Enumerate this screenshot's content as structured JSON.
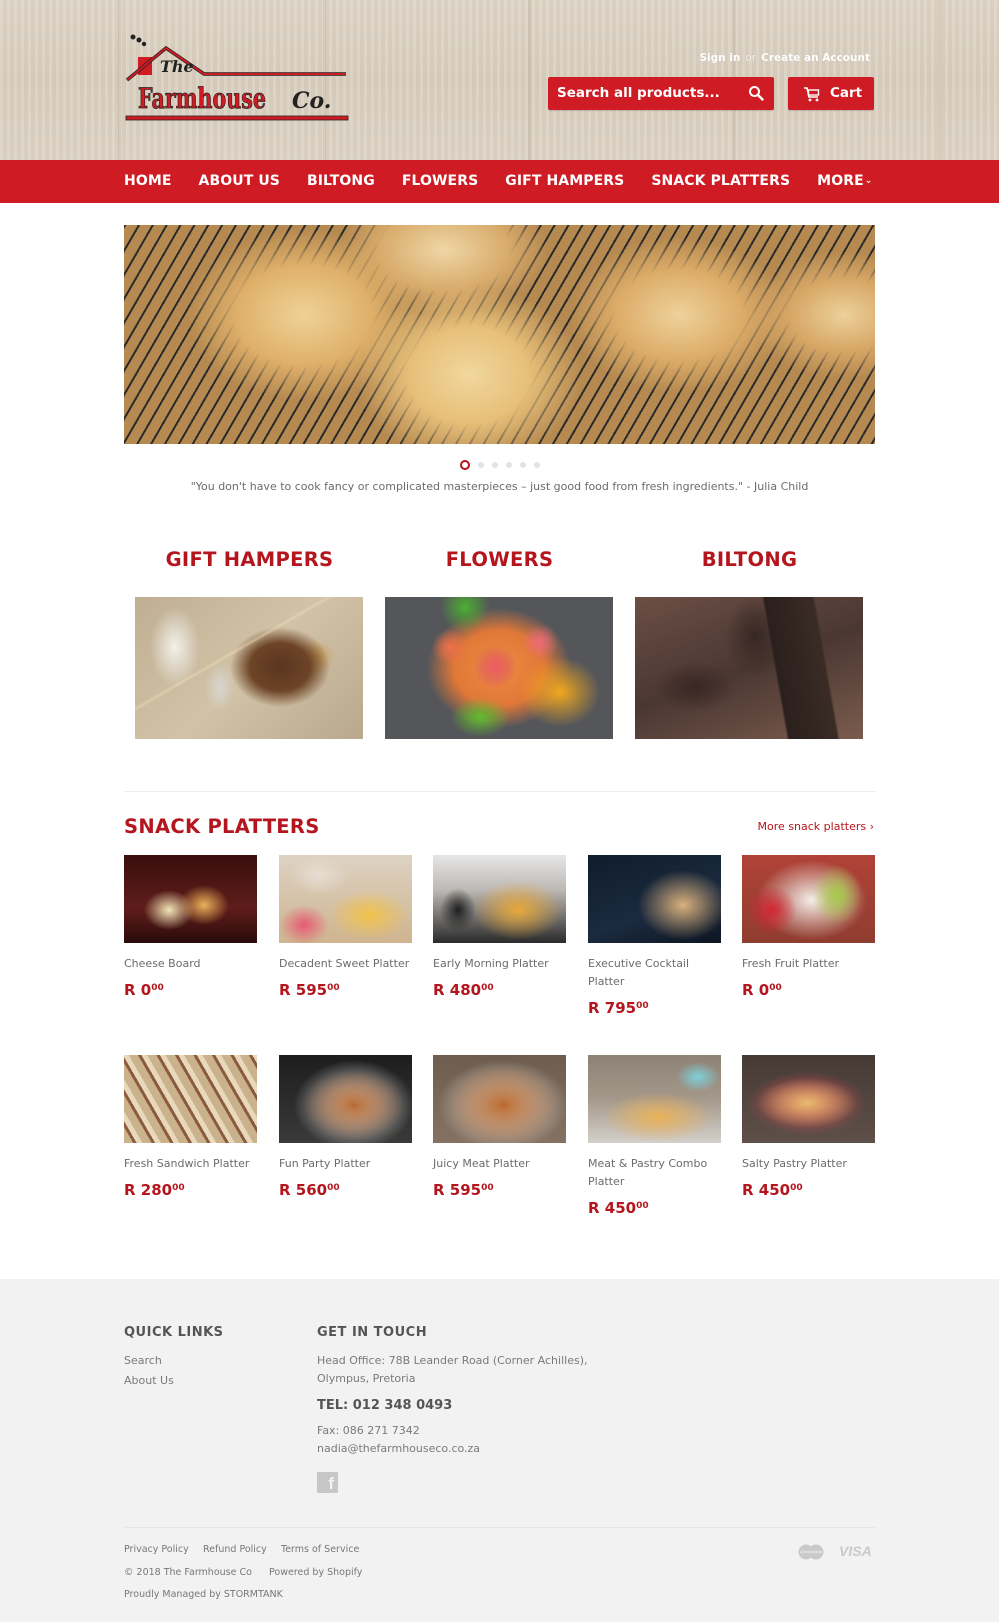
{
  "brand": {
    "logo_text_the": "The",
    "logo_text_main": "Farmhouse",
    "logo_text_co": "Co.",
    "primary_color": "#cf1b23",
    "heading_color": "#b5161e"
  },
  "header": {
    "sign_in": "Sign in",
    "or": "or",
    "create_account": "Create an Account",
    "search_placeholder": "Search all products...",
    "search_icon": "search-icon",
    "cart_label": "Cart",
    "cart_icon": "cart-icon"
  },
  "nav": {
    "items": [
      {
        "label": "HOME"
      },
      {
        "label": "ABOUT US"
      },
      {
        "label": "BILTONG"
      },
      {
        "label": "FLOWERS"
      },
      {
        "label": "GIFT HAMPERS"
      },
      {
        "label": "SNACK PLATTERS"
      },
      {
        "label": "MORE",
        "icon": "chevron-down-icon"
      }
    ]
  },
  "slideshow": {
    "slide_count": 6,
    "active_slide": 1,
    "quote": "\"You don't have to cook fancy or complicated masterpieces – just good food from fresh ingredients.\" - Julia Child"
  },
  "collections": [
    {
      "title": "GIFT HAMPERS"
    },
    {
      "title": "FLOWERS"
    },
    {
      "title": "BILTONG"
    }
  ],
  "snack_platters": {
    "title": "SNACK PLATTERS",
    "more_link": "More snack platters ›",
    "products": [
      {
        "name": "Cheese Board",
        "price_main": "R 0",
        "price_cents": "00"
      },
      {
        "name": "Decadent Sweet Platter",
        "price_main": "R 595",
        "price_cents": "00"
      },
      {
        "name": "Early Morning Platter",
        "price_main": "R 480",
        "price_cents": "00"
      },
      {
        "name": "Executive Cocktail Platter",
        "price_main": "R 795",
        "price_cents": "00"
      },
      {
        "name": "Fresh Fruit Platter",
        "price_main": "R 0",
        "price_cents": "00"
      },
      {
        "name": "Fresh Sandwich Platter",
        "price_main": "R 280",
        "price_cents": "00"
      },
      {
        "name": "Fun Party Platter",
        "price_main": "R 560",
        "price_cents": "00"
      },
      {
        "name": "Juicy Meat Platter",
        "price_main": "R 595",
        "price_cents": "00"
      },
      {
        "name": "Meat & Pastry Combo Platter",
        "price_main": "R 450",
        "price_cents": "00"
      },
      {
        "name": "Salty Pastry Platter",
        "price_main": "R 450",
        "price_cents": "00"
      }
    ]
  },
  "footer": {
    "quick_links_title": "QUICK LINKS",
    "quick_links": [
      "Search",
      "About Us"
    ],
    "contact_title": "GET IN TOUCH",
    "address_line1": "Head Office: 78B Leander Road (Corner Achilles),",
    "address_line2": "Olympus, Pretoria",
    "tel": "TEL: 012 348 0493",
    "fax": "Fax: 086 271 7342",
    "email": "nadia@thefarmhouseco.co.za",
    "social_icon": "facebook-icon",
    "policies": [
      "Privacy Policy",
      "Refund Policy",
      "Terms of Service"
    ],
    "copyright": "© 2018 The Farmhouse Co",
    "powered_by": "Powered by Shopify",
    "managed_by": "Proudly Managed by STORMTANK",
    "payment_methods": [
      "mastercard-icon",
      "VISA"
    ]
  }
}
